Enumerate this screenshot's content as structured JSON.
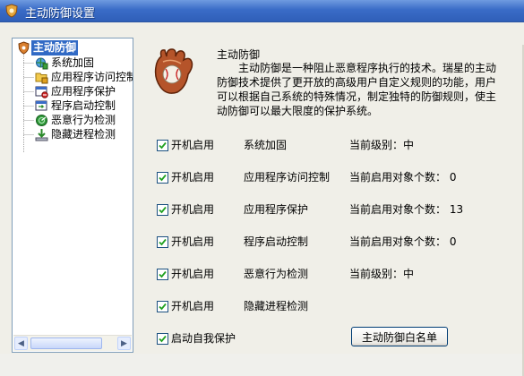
{
  "window": {
    "title": "主动防御设置",
    "icon": "shield-app-icon"
  },
  "tree": {
    "root": {
      "label": "主动防御",
      "icon": "shield-icon"
    },
    "items": [
      {
        "label": "系统加固",
        "icon": "globe-shield-icon"
      },
      {
        "label": "应用程序访问控制",
        "icon": "folder-lock-icon"
      },
      {
        "label": "应用程序保护",
        "icon": "window-protect-icon"
      },
      {
        "label": "程序启动控制",
        "icon": "window-launch-icon"
      },
      {
        "label": "恶意行为检测",
        "icon": "radar-icon"
      },
      {
        "label": "隐藏进程检测",
        "icon": "download-arrow-icon"
      }
    ]
  },
  "info": {
    "title": "主动防御",
    "description": "主动防御是一种阻止恶意程序执行的技术。瑞星的主动防御技术提供了更开放的高级用户自定义规则的功能，用户可以根据自己系统的特殊情况，制定独特的防御规则，使主动防御可以最大限度的保护系统。"
  },
  "modules": [
    {
      "enabled": true,
      "enable_label": "开机启用",
      "name": "系统加固",
      "status": "当前级别：中"
    },
    {
      "enabled": true,
      "enable_label": "开机启用",
      "name": "应用程序访问控制",
      "status": "当前启用对象个数： 0"
    },
    {
      "enabled": true,
      "enable_label": "开机启用",
      "name": "应用程序保护",
      "status": "当前启用对象个数： 13"
    },
    {
      "enabled": true,
      "enable_label": "开机启用",
      "name": "程序启动控制",
      "status": "当前启用对象个数： 0"
    },
    {
      "enabled": true,
      "enable_label": "开机启用",
      "name": "恶意行为检测",
      "status": "当前级别：中"
    },
    {
      "enabled": true,
      "enable_label": "开机启用",
      "name": "隐藏进程检测",
      "status": ""
    }
  ],
  "self_protect": {
    "enabled": true,
    "label": "启动自我保护"
  },
  "whitelist_button": "主动防御白名单",
  "colors": {
    "title_bar": "#3a6cc7",
    "selection": "#316ac5",
    "checkmark": "#21a121",
    "glove": "#b5542a"
  }
}
